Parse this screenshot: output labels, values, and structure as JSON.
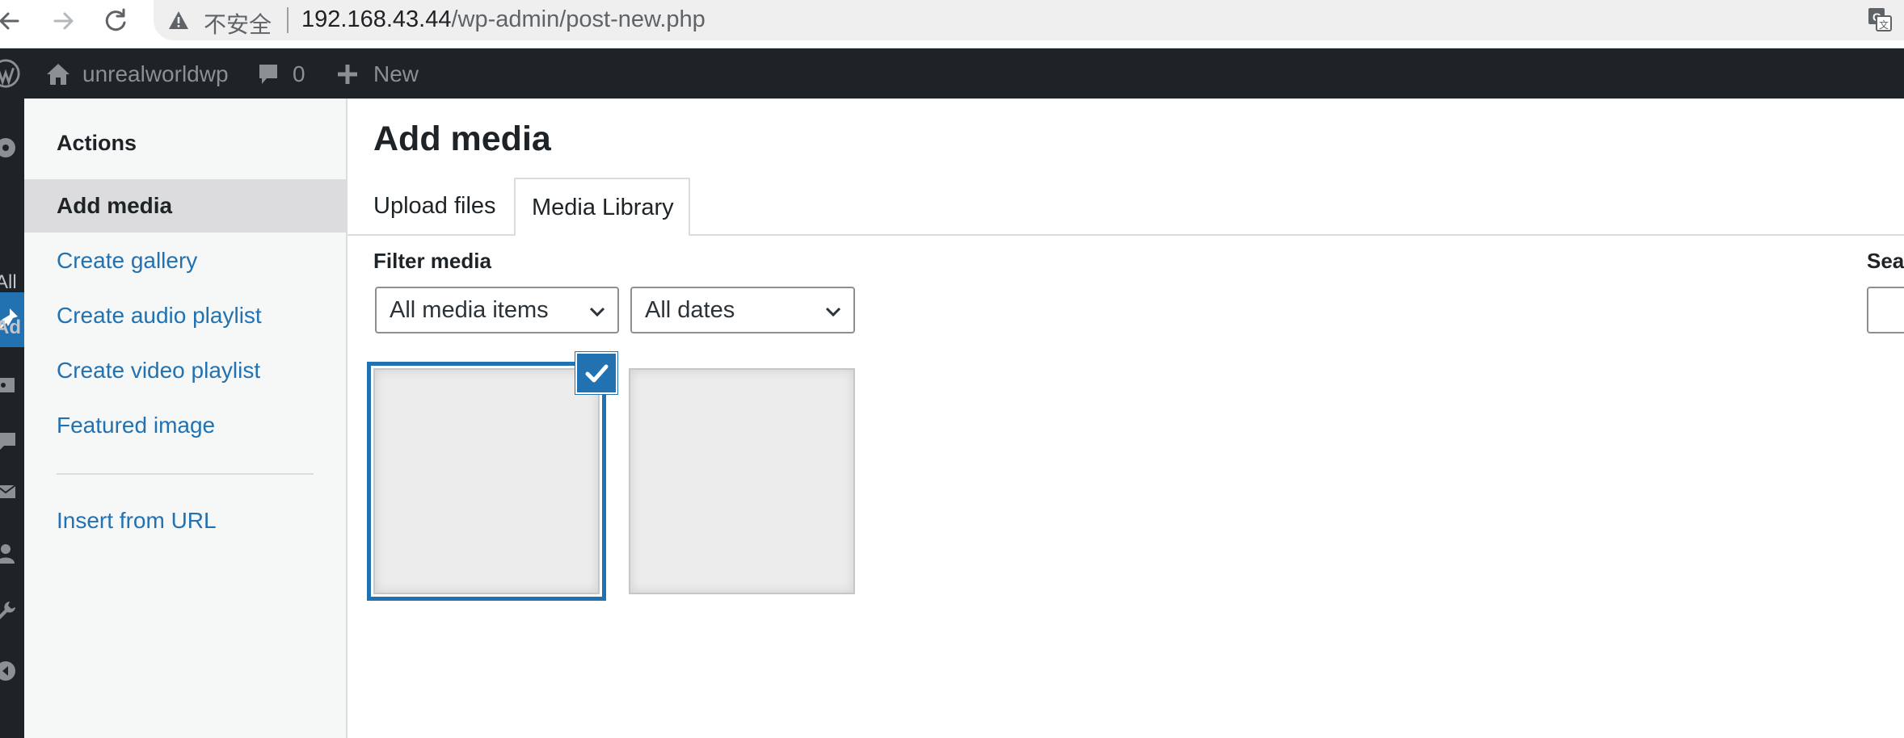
{
  "browser": {
    "security_label": "不安全",
    "url_host": "192.168.43.44",
    "url_path": "/wp-admin/post-new.php"
  },
  "admin_bar": {
    "site_name": "unrealworldwp",
    "comments_count": "0",
    "new_label": "New"
  },
  "admin_menu": {
    "partial_labels": [
      "All",
      "Ad"
    ]
  },
  "modal": {
    "sidebar": {
      "heading": "Actions",
      "items": [
        {
          "label": "Add media",
          "active": true
        },
        {
          "label": "Create gallery"
        },
        {
          "label": "Create audio playlist"
        },
        {
          "label": "Create video playlist"
        },
        {
          "label": "Featured image"
        },
        {
          "label": "Insert from URL"
        }
      ]
    },
    "title": "Add media",
    "tabs": [
      {
        "label": "Upload files",
        "active": false
      },
      {
        "label": "Media Library",
        "active": true
      }
    ],
    "filter": {
      "label": "Filter media",
      "type_select": "All media items",
      "date_select": "All dates"
    },
    "search_label": "Sea",
    "attachments": [
      {
        "selected": true
      },
      {
        "selected": false
      }
    ]
  },
  "colors": {
    "admin_bar_bg": "#1d2327",
    "accent": "#2271b1",
    "link": "#2271b1"
  }
}
